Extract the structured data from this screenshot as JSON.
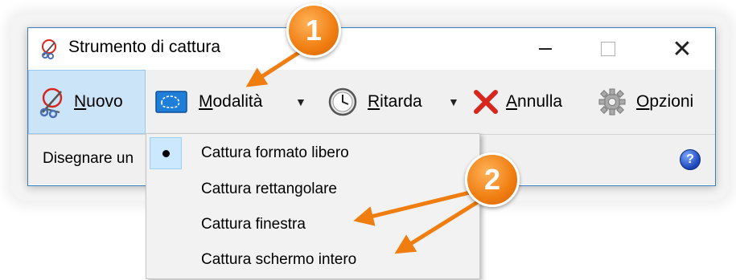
{
  "window": {
    "title": "Strumento di cattura",
    "minimize_label": "",
    "maximize_label": "",
    "close_label": "✕"
  },
  "toolbar": {
    "nuovo_label": "Nuovo",
    "modalita_label": "Modalità",
    "ritarda_label": "Ritarda",
    "annulla_label": "Annulla",
    "opzioni_label": "Opzioni"
  },
  "status": {
    "text": "Disegnare un",
    "help_glyph": "?"
  },
  "mode_menu": {
    "items": [
      {
        "label": "Cattura formato libero",
        "checked": true
      },
      {
        "label": "Cattura rettangolare",
        "checked": false
      },
      {
        "label": "Cattura finestra",
        "checked": false
      },
      {
        "label": "Cattura schermo intero",
        "checked": false
      }
    ]
  },
  "callouts": {
    "badge1": "1",
    "badge2": "2"
  },
  "colors": {
    "accent_orange": "#f07d10",
    "selected_blue": "#cce4f7",
    "window_border": "#3c7fc1",
    "cancel_red": "#d9261c"
  }
}
